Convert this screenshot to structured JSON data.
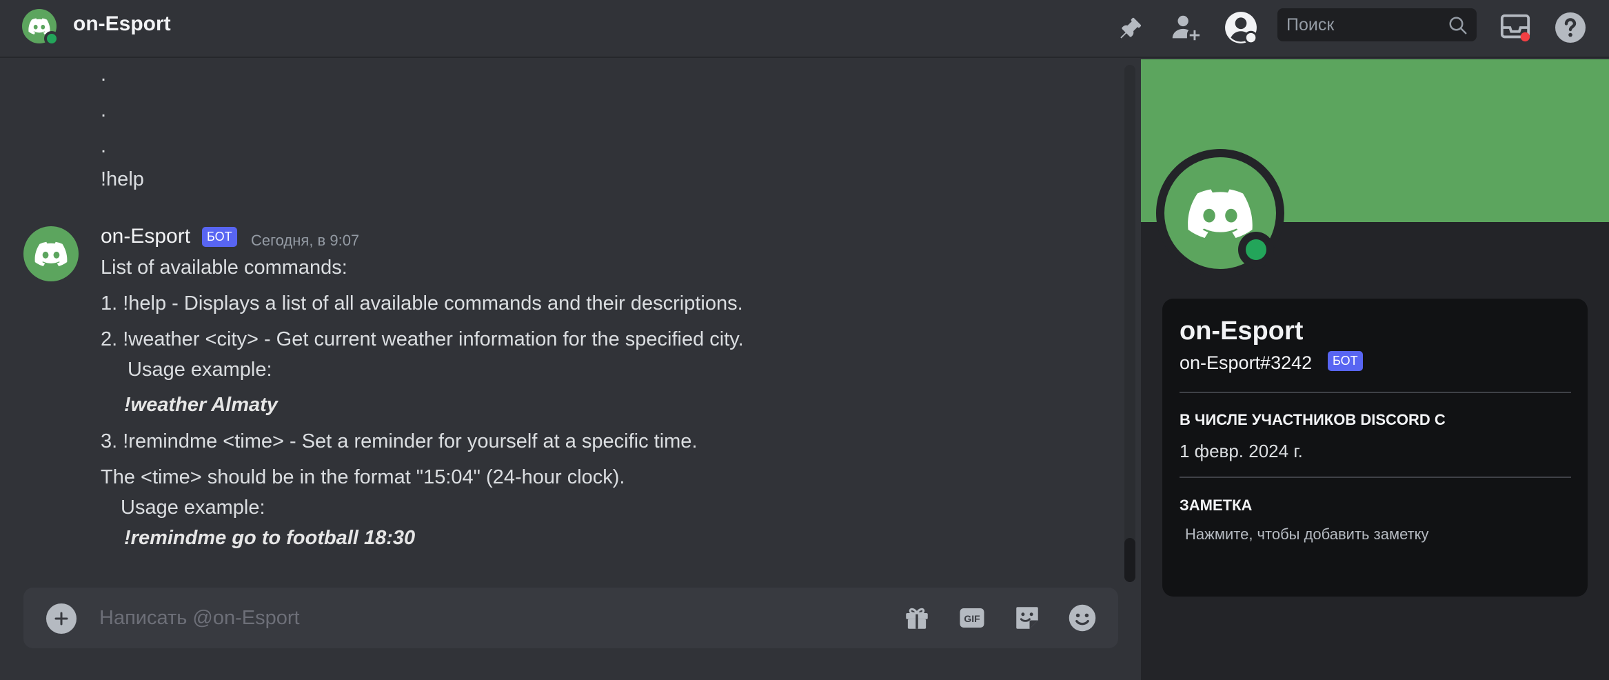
{
  "header": {
    "title": "on-Esport",
    "search_placeholder": "Поиск",
    "icons": [
      "pin-icon",
      "add-friend-icon",
      "user-profile-icon",
      "search-icon",
      "inbox-icon",
      "help-icon"
    ]
  },
  "chat": {
    "previous_lines": [
      ".",
      ".",
      ".",
      "!help"
    ],
    "message": {
      "author": "on-Esport",
      "badge": "БОТ",
      "timestamp": "Сегодня, в 9:07",
      "lines": {
        "l1": "List of available commands:",
        "l2": "1. !help - Displays a list of all available commands and their descriptions.",
        "l3": "2. !weather <city> - Get current weather information for the specified city.",
        "l4": "Usage example:",
        "l5": "!weather Almaty",
        "l6": "3. !remindme <time> - Set a reminder for yourself at a specific time.",
        "l7": "The <time> should be in the format \"15:04\" (24-hour clock).",
        "l8": "Usage example:",
        "l9": "!remindme go to football 18:30"
      }
    }
  },
  "composer": {
    "placeholder": "Написать @on-Esport",
    "gif_label": "GIF"
  },
  "profile": {
    "name": "on-Esport",
    "tag": "on-Esport#3242",
    "badge": "БОТ",
    "member_since_title": "В ЧИСЛЕ УЧАСТНИКОВ DISCORD С",
    "member_since_value": "1 февр. 2024 г.",
    "note_title": "ЗАМЕТКА",
    "note_placeholder": "Нажмите, чтобы добавить заметку"
  },
  "colors": {
    "brand_green": "#5ca55e",
    "online": "#23a55a",
    "bot_badge": "#5865f2",
    "background": "#313338"
  }
}
